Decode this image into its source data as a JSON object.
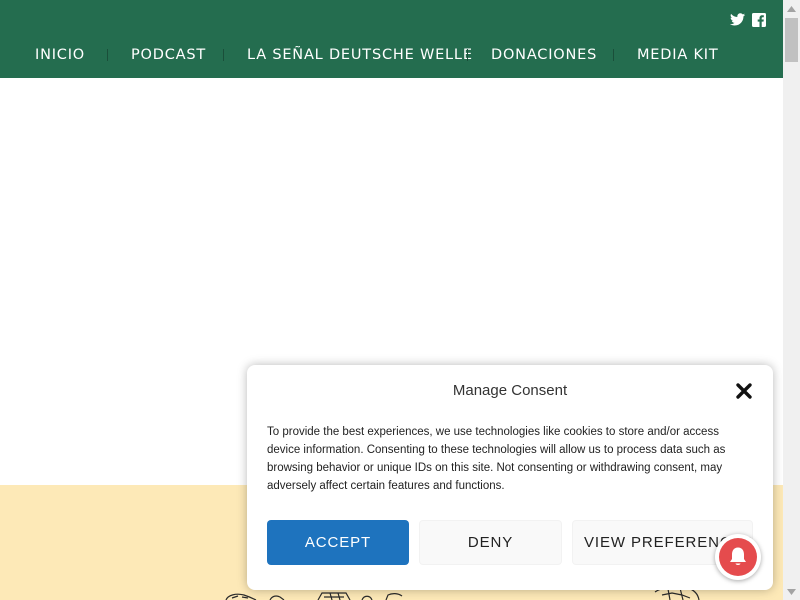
{
  "header": {
    "nav": [
      {
        "label": "INICIO"
      },
      {
        "label": "PODCAST"
      },
      {
        "label": "LA SEÑAL DEUTSCHE WELLE"
      },
      {
        "label": "DONACIONES"
      },
      {
        "label": "MEDIA KIT"
      }
    ],
    "social": [
      {
        "icon": "twitter-icon"
      },
      {
        "icon": "facebook-icon"
      }
    ],
    "background_color": "#246d4f"
  },
  "band": {
    "background_color": "#fde9b7"
  },
  "consent": {
    "title": "Manage Consent",
    "body": "To provide the best experiences, we use technologies like cookies to store and/or access device information. Consenting to these technologies will allow us to process data such as browsing behavior or unique IDs on this site. Not consenting or withdrawing consent, may adversely affect certain features and functions.",
    "accept_label": "ACCEPT",
    "deny_label": "DENY",
    "preferences_label": "VIEW PREFERENCES",
    "accent_color": "#1e73be"
  },
  "notification": {
    "icon": "bell-icon",
    "color": "#e54b4d"
  }
}
